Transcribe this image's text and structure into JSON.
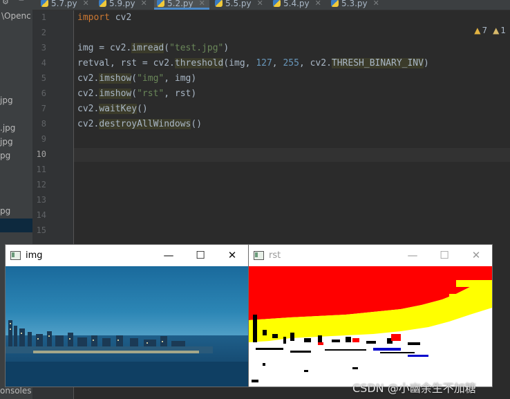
{
  "sidebar": {
    "path_fragment": "\\Openc",
    "items": [
      "jpg",
      ".jpg",
      "jpg",
      "pg",
      "pg"
    ],
    "bottom_label": "onsoles"
  },
  "tabs": [
    {
      "label": "5.7.py",
      "active": false
    },
    {
      "label": "5.9.py",
      "active": false
    },
    {
      "label": "5.2.py",
      "active": true
    },
    {
      "label": "5.5.py",
      "active": false
    },
    {
      "label": "5.4.py",
      "active": false
    },
    {
      "label": "5.3.py",
      "active": false
    }
  ],
  "editor": {
    "line_numbers": [
      "1",
      "2",
      "3",
      "4",
      "5",
      "6",
      "7",
      "8",
      "9",
      "10",
      "11",
      "12",
      "13",
      "14",
      "15"
    ],
    "current_line": "10",
    "warnings": {
      "count": "7",
      "weak_count": "1"
    }
  },
  "code": {
    "l1_kw": "import",
    "l1_mod": " cv2",
    "l3_a": "img = cv2.",
    "l3_fn": "imread",
    "l3_b": "(",
    "l3_str": "\"test.jpg\"",
    "l3_c": ")",
    "l4_a": "retval, rst = cv2.",
    "l4_fn": "threshold",
    "l4_b": "(img, ",
    "l4_n1": "127",
    "l4_c": ", ",
    "l4_n2": "255",
    "l4_d": ", cv2.",
    "l4_const": "THRESH_BINARY_INV",
    "l4_e": ")",
    "l5_a": "cv2.",
    "l5_fn": "imshow",
    "l5_b": "(",
    "l5_str": "\"img\"",
    "l5_c": ", img)",
    "l6_a": "cv2.",
    "l6_fn": "imshow",
    "l6_b": "(",
    "l6_str": "\"rst\"",
    "l6_c": ", rst)",
    "l7_a": "cv2.",
    "l7_fn": "waitKey",
    "l7_b": "()",
    "l8_a": "cv2.",
    "l8_fn": "destroyAllWindows",
    "l8_b": "()"
  },
  "windows": {
    "img": {
      "title": "img",
      "minimize": "—",
      "maximize": "☐",
      "close": "✕"
    },
    "rst": {
      "title": "rst",
      "minimize": "—",
      "maximize": "☐",
      "close": "✕"
    }
  },
  "watermark": "CSDN @小幽余生不加糖",
  "colors": {
    "editor_bg": "#2b2b2b",
    "keyword": "#cc7832",
    "string": "#6a8759",
    "number": "#6897bb",
    "threshold_red": "#ff0000",
    "threshold_yellow": "#ffff00"
  }
}
